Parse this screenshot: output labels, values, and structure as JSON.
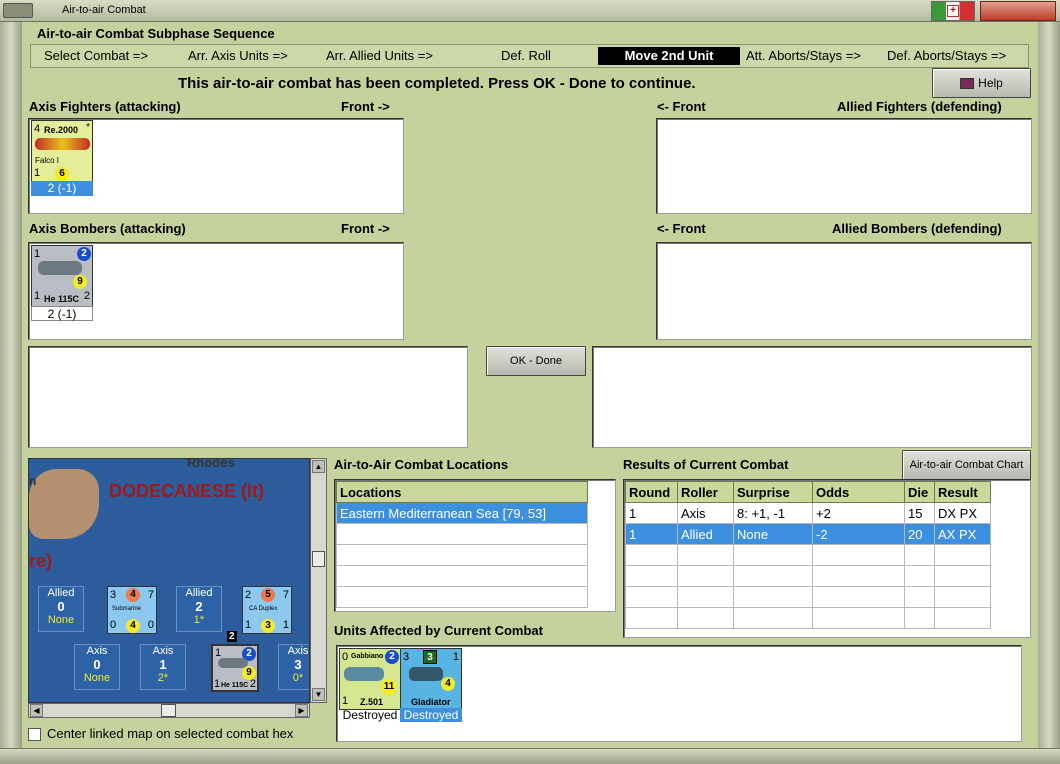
{
  "window": {
    "title": "Air-to-air Combat"
  },
  "sequence": {
    "title": "Air-to-air Combat Subphase Sequence",
    "steps": [
      "Select Combat =>",
      "Arr. Axis Units =>",
      "Arr. Allied Units =>",
      "Def. Roll",
      "Move 2nd Unit",
      "Att. Aborts/Stays =>",
      "Def. Aborts/Stays =>"
    ],
    "active_step": "Move 2nd Unit"
  },
  "message": "This air-to-air combat has been completed.  Press OK - Done to continue.",
  "help_label": "Help",
  "ok_label": "OK - Done",
  "chart_button_label": "Air-to-air Combat Chart",
  "sections": {
    "axis_fighters": "Axis Fighters (attacking)",
    "axis_fighters_front": "Front ->",
    "allied_fighters": "Allied Fighters (defending)",
    "allied_fighters_front": "<- Front",
    "axis_bombers": "Axis Bombers (attacking)",
    "axis_bombers_front": "Front ->",
    "allied_bombers": "Allied Bombers (defending)",
    "allied_bombers_front": "<- Front",
    "locations": "Air-to-Air Combat Locations",
    "results": "Results of Current Combat",
    "affected": "Units Affected by Current Combat"
  },
  "units": {
    "fighter": {
      "tl": "4",
      "name": "Re.2000",
      "sub": "Falco I",
      "bl": "1",
      "val": "6",
      "star": "*",
      "caption": "2 (-1)"
    },
    "bomber": {
      "tl": "1",
      "range": "2",
      "val": "9",
      "bl": "1",
      "br": "2",
      "name": "He 115C",
      "caption": "2 (-1)"
    },
    "affected_1": {
      "tl": "0",
      "name": "Gabbiano",
      "range": "2",
      "val": "11",
      "bl": "1",
      "code": "Z.501",
      "caption": "Destroyed"
    },
    "affected_2": {
      "tl": "3",
      "box": "3",
      "tr": "1",
      "val": "4",
      "name": "Gladiator",
      "caption": "Destroyed"
    }
  },
  "map": {
    "place_rhodes": "Rhodes",
    "region": "DODECANESE (It)",
    "frag_re": "re)",
    "frag_n": "n",
    "zones": [
      {
        "side": "Allied",
        "value": "0",
        "sub": "None"
      },
      {
        "side": "Allied",
        "value": "2",
        "sub": "1*"
      },
      {
        "side": "Axis",
        "value": "0",
        "sub": "None"
      },
      {
        "side": "Axis",
        "value": "1",
        "sub": "2*"
      },
      {
        "side": "Axis",
        "value": "3",
        "sub": "0*"
      }
    ],
    "sub": {
      "a": "3",
      "b": "4",
      "c": "7",
      "d": "0",
      "e": "4",
      "f": "0",
      "name": "Submarine"
    },
    "ca": {
      "a": "2",
      "b": "5",
      "c": "7",
      "d": "1",
      "e": "3",
      "f": "1",
      "name": "CA Duplex"
    },
    "stack_count": "2",
    "bomb": {
      "tl": "1",
      "range": "2",
      "val": "9",
      "bl": "1",
      "br": "2",
      "name": "He 115C"
    }
  },
  "center_linked_label": "Center linked map on selected combat hex",
  "locations_table": {
    "header": "Locations",
    "rows": [
      "Eastern Mediterranean Sea [79, 53]"
    ]
  },
  "results_table": {
    "headers": [
      "Round",
      "Roller",
      "Surprise",
      "Odds",
      "Die",
      "Result"
    ],
    "rows": [
      [
        "1",
        "Axis",
        "8: +1, -1",
        "+2",
        "15",
        "DX PX"
      ],
      [
        "1",
        "Allied",
        "None",
        "-2",
        "20",
        "AX PX"
      ]
    ],
    "selected_row": 1
  }
}
